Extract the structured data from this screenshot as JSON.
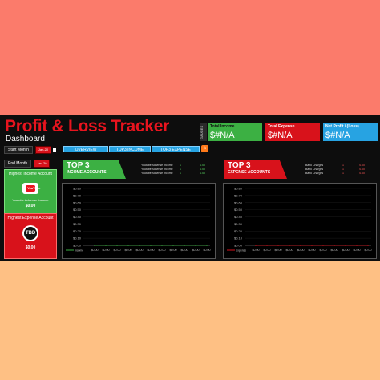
{
  "header": {
    "title": "Profit & Loss Tracker",
    "subtitle": "Dashboard"
  },
  "kpi_section_label": "GAUGES",
  "kpis": [
    {
      "label": "Total Income",
      "value": "$#N/A",
      "color": "#3cb043"
    },
    {
      "label": "Total Expense",
      "value": "$#N/A",
      "color": "#d8121b"
    },
    {
      "label": "Net Profit / (Loss)",
      "value": "$#N/A",
      "color": "#27a3e2"
    }
  ],
  "filters": {
    "start_month_label": "Start Month",
    "start_month_value": "Jan-20",
    "end_month_label": "End Month",
    "end_month_value": "Jan-20"
  },
  "tabs": [
    "OVERVIEW",
    "TOP3 INCOME",
    "TOP3 EXPENSE"
  ],
  "home_icon": "home-icon",
  "highest_income": {
    "heading": "Highest Income Account",
    "logo_text": "YouTube",
    "account": "Youtube Adsense Income",
    "value": "$0.00"
  },
  "highest_expense": {
    "heading": "Highest Expense Account",
    "badge": "TBD",
    "value": "$0.00"
  },
  "top3_income": {
    "big": "TOP 3",
    "small": "INCOME ACCOUNTS",
    "rows": [
      {
        "account": "Youtube Adsense Income",
        "count": "1",
        "amount": "0.00"
      },
      {
        "account": "Youtube Adsense Income",
        "count": "1",
        "amount": "0.00"
      },
      {
        "account": "Youtube Adsense Income",
        "count": "1",
        "amount": "0.00"
      }
    ]
  },
  "top3_expense": {
    "big": "TOP 3",
    "small": "EXPENSE ACCOUNTS",
    "rows": [
      {
        "account": "Bank Charges",
        "count": "1",
        "amount": "0.00"
      },
      {
        "account": "Bank Charges",
        "count": "1",
        "amount": "0.00"
      },
      {
        "account": "Bank Charges",
        "count": "1",
        "amount": "0.00"
      }
    ]
  },
  "chart_data": [
    {
      "type": "line",
      "y_ticks": [
        "$0.80",
        "$0.70",
        "$0.60",
        "$0.50",
        "$0.40",
        "$0.30",
        "$0.20",
        "$0.10",
        "$0.00"
      ],
      "x_labels": [
        "$0.00",
        "$0.00",
        "$0.00",
        "$0.00",
        "$0.00",
        "$0.00",
        "$0.00",
        "$0.00",
        "$0.00",
        "$0.00",
        "$0.00"
      ],
      "series_label": "Income",
      "series_color": "#3cb043",
      "values": [
        0,
        0,
        0,
        0,
        0,
        0,
        0,
        0,
        0,
        0,
        0
      ],
      "ylim": [
        0,
        0.8
      ]
    },
    {
      "type": "line",
      "y_ticks": [
        "$0.80",
        "$0.70",
        "$0.60",
        "$0.50",
        "$0.40",
        "$0.30",
        "$0.20",
        "$0.10",
        "$0.00"
      ],
      "x_labels": [
        "$0.00",
        "$0.00",
        "$0.00",
        "$0.00",
        "$0.00",
        "$0.00",
        "$0.00",
        "$0.00",
        "$0.00",
        "$0.00",
        "$0.00"
      ],
      "series_label": "Expense",
      "series_color": "#d8121b",
      "values": [
        0,
        0,
        0,
        0,
        0,
        0,
        0,
        0,
        0,
        0,
        0
      ],
      "ylim": [
        0,
        0.8
      ]
    }
  ]
}
